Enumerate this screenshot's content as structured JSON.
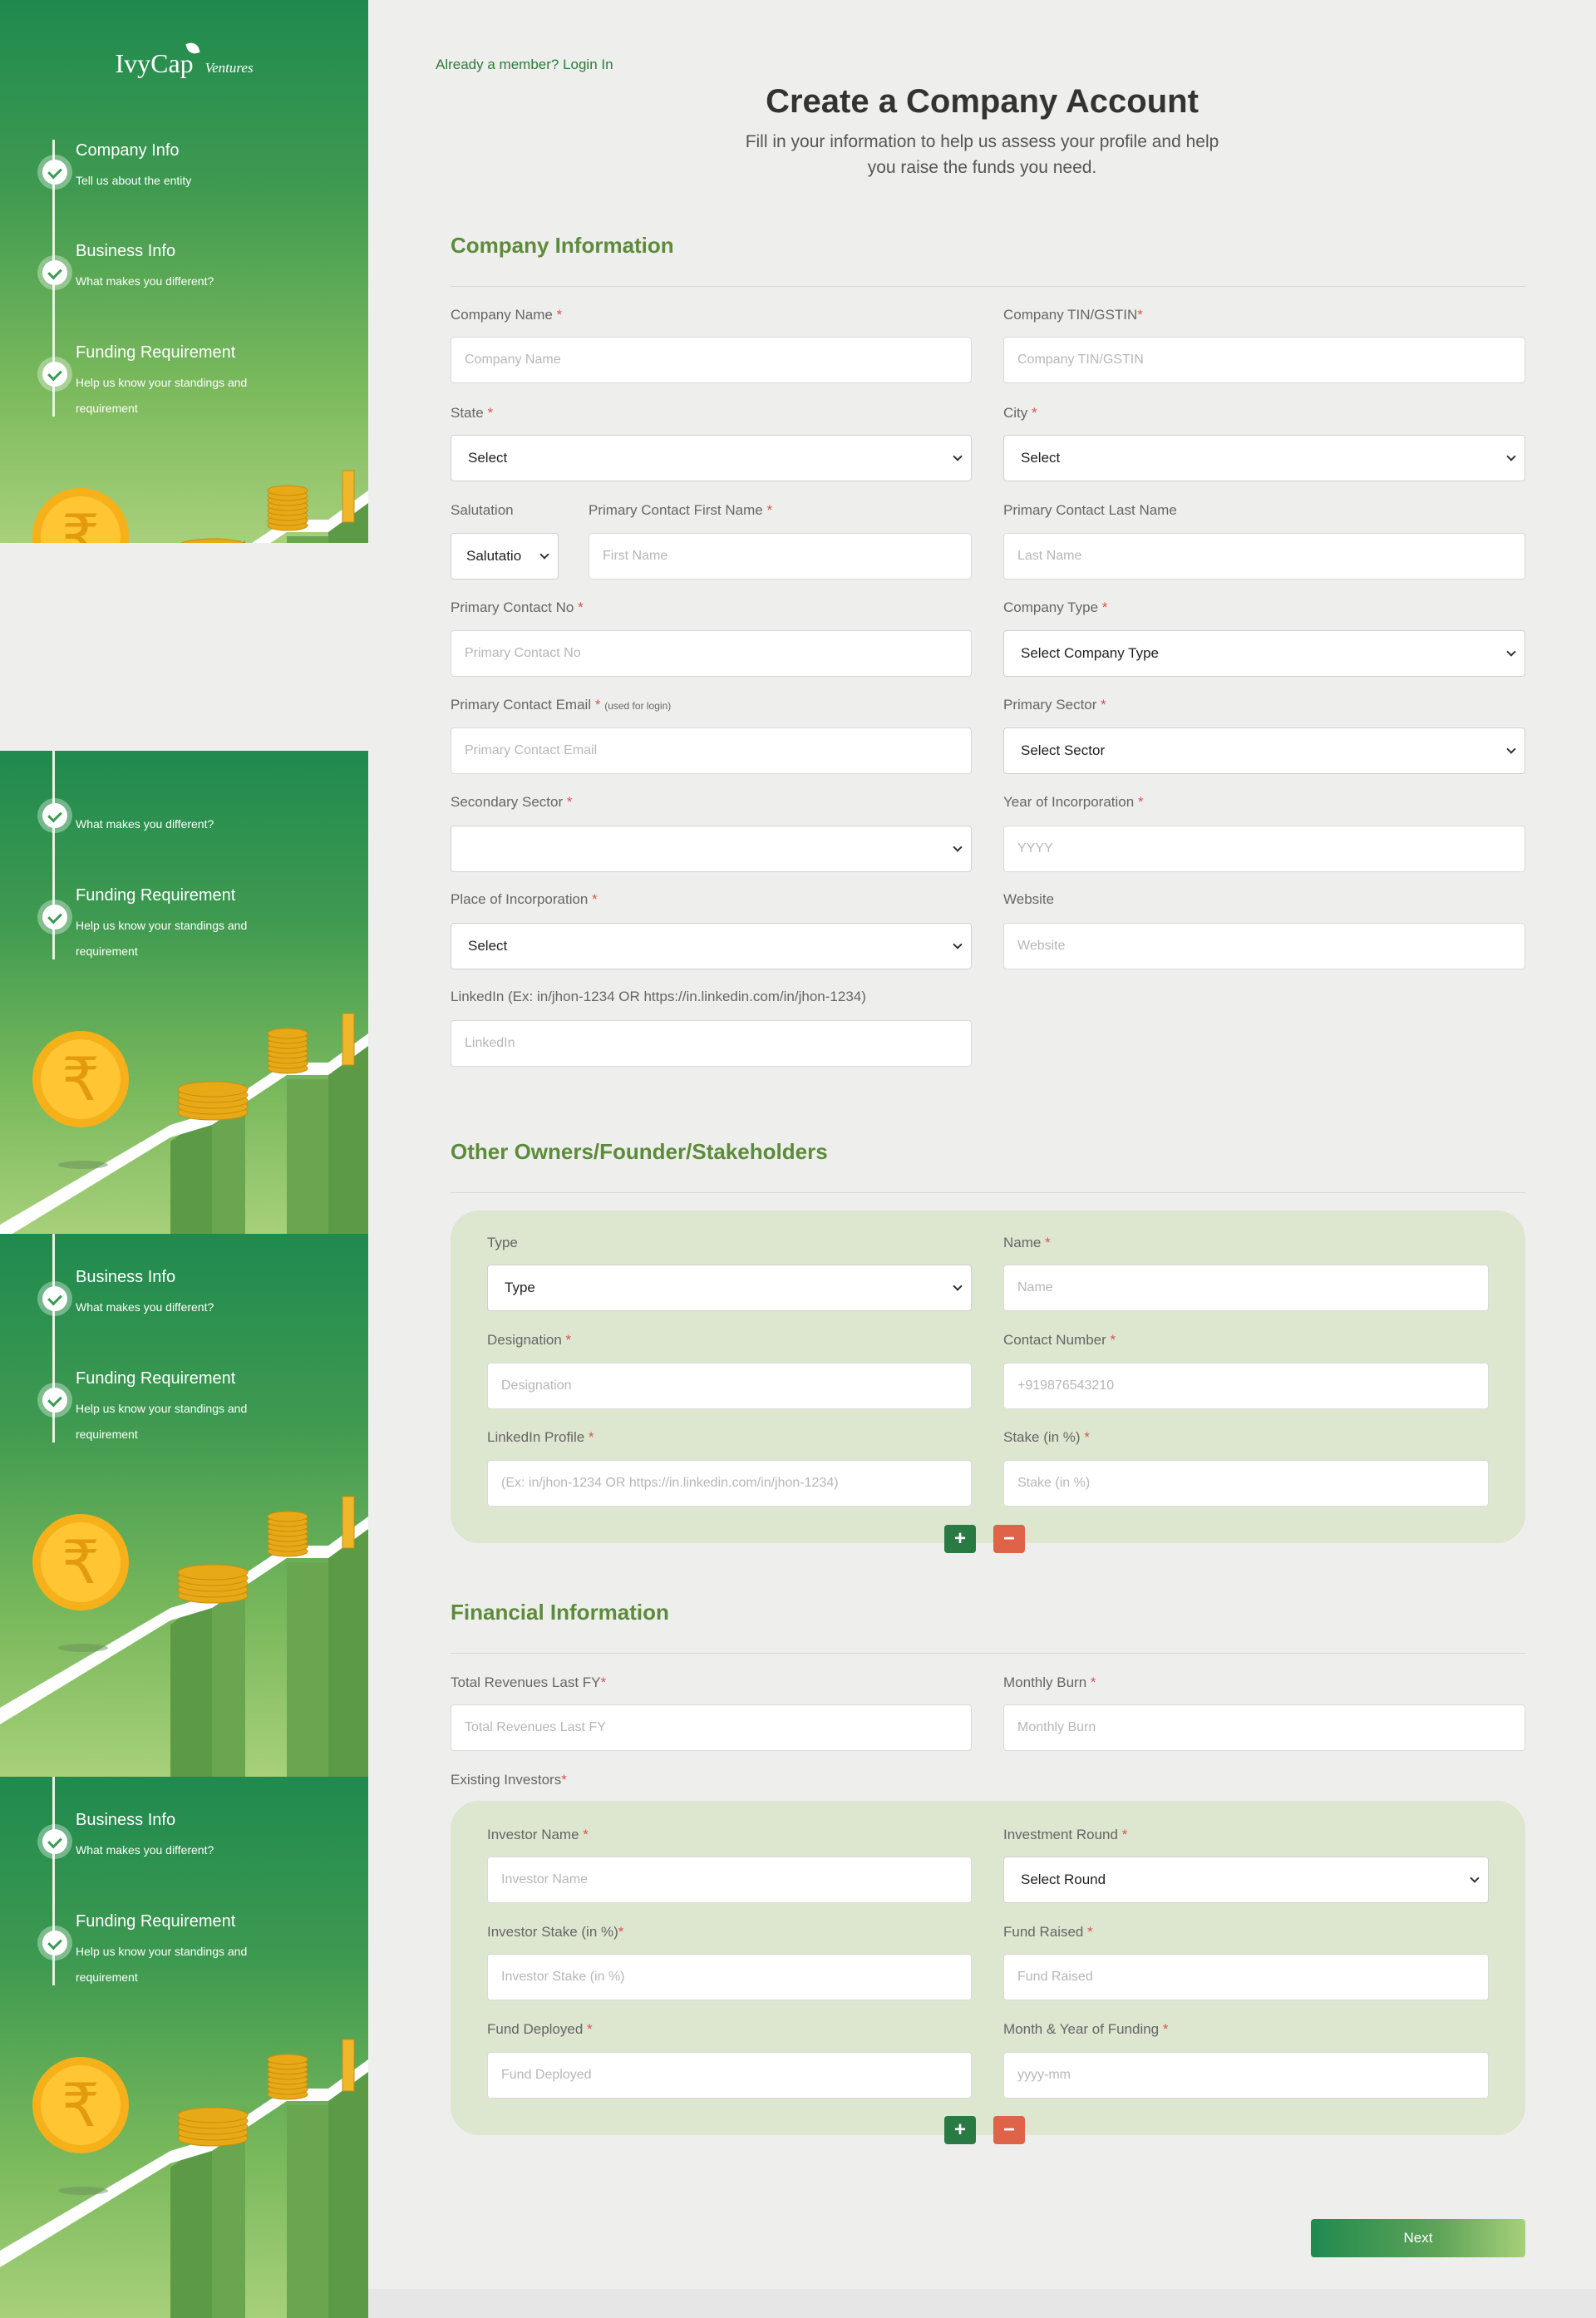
{
  "brand": {
    "name": "IvyCap",
    "suffix": "Ventures"
  },
  "sidebar": {
    "panels": [
      {
        "steps": [
          {
            "title": "Company Info",
            "desc": "Tell us about the entity"
          },
          {
            "title": "Business Info",
            "desc": "What makes you different?"
          },
          {
            "title": "Funding Requirement",
            "desc": "Help us know your standings and requirement"
          }
        ]
      },
      {
        "steps": [
          {
            "title": "",
            "desc": "What makes you different?"
          },
          {
            "title": "Funding Requirement",
            "desc": "Help us know your standings and requirement"
          }
        ]
      },
      {
        "steps": [
          {
            "title": "Business Info",
            "desc": "What makes you different?"
          },
          {
            "title": "Funding Requirement",
            "desc": "Help us know your standings and requirement"
          }
        ]
      },
      {
        "steps": [
          {
            "title": "Business Info",
            "desc": "What makes you different?"
          },
          {
            "title": "Funding Requirement",
            "desc": "Help us know your standings and requirement"
          }
        ]
      }
    ],
    "rupee_symbol": "₹"
  },
  "header": {
    "login_link": "Already a member? Login In",
    "title": "Create a Company Account",
    "subtitle_line1": "Fill in your information to help us assess your profile and help",
    "subtitle_line2": "you raise the funds you need."
  },
  "company": {
    "section_title": "Company Information",
    "company_name": {
      "label": "Company Name",
      "placeholder": "Company Name"
    },
    "tin": {
      "label": "Company TIN/GSTIN",
      "placeholder": "Company TIN/GSTIN"
    },
    "state": {
      "label": "State",
      "value": "Select"
    },
    "city": {
      "label": "City",
      "value": "Select"
    },
    "salutation": {
      "label": "Salutation",
      "value": "Salutatio"
    },
    "first_name": {
      "label": "Primary Contact First Name",
      "placeholder": "First Name"
    },
    "last_name": {
      "label": "Primary Contact Last Name",
      "placeholder": "Last Name"
    },
    "contact_no": {
      "label": "Primary Contact No",
      "placeholder": "Primary Contact No"
    },
    "company_type": {
      "label": "Company Type",
      "value": "Select Company Type"
    },
    "email": {
      "label": "Primary Contact Email",
      "note": "(used for login)",
      "placeholder": "Primary Contact Email"
    },
    "primary_sector": {
      "label": "Primary Sector",
      "value": "Select Sector"
    },
    "secondary_sector": {
      "label": "Secondary Sector",
      "value": ""
    },
    "year": {
      "label": "Year of Incorporation",
      "placeholder": "YYYY"
    },
    "place": {
      "label": "Place of Incorporation",
      "value": "Select"
    },
    "website": {
      "label": "Website",
      "placeholder": "Website"
    },
    "linkedin": {
      "label": "LinkedIn (Ex: in/jhon-1234 OR https://in.linkedin.com/in/jhon-1234)",
      "placeholder": "LinkedIn"
    }
  },
  "owners": {
    "section_title": "Other Owners/Founder/Stakeholders",
    "type": {
      "label": "Type",
      "value": "Type"
    },
    "name": {
      "label": "Name",
      "placeholder": "Name"
    },
    "designation": {
      "label": "Designation",
      "placeholder": "Designation"
    },
    "contact": {
      "label": "Contact Number",
      "placeholder": "+919876543210"
    },
    "linkedin": {
      "label": "LinkedIn Profile",
      "placeholder": "(Ex: in/jhon-1234 OR https://in.linkedin.com/in/jhon-1234)"
    },
    "stake": {
      "label": "Stake (in %)",
      "placeholder": "Stake (in %)"
    },
    "add_symbol": "+",
    "remove_symbol": "−"
  },
  "financial": {
    "section_title": "Financial Information",
    "revenues": {
      "label": "Total Revenues Last FY",
      "placeholder": "Total Revenues Last FY"
    },
    "burn": {
      "label": "Monthly Burn",
      "placeholder": "Monthly Burn"
    },
    "existing_label": "Existing Investors",
    "investor_name": {
      "label": "Investor Name",
      "placeholder": "Investor Name"
    },
    "round": {
      "label": "Investment Round",
      "value": "Select Round"
    },
    "investor_stake": {
      "label": "Investor Stake (in %)",
      "placeholder": "Investor Stake (in %)"
    },
    "fund_raised": {
      "label": "Fund Raised",
      "placeholder": "Fund Raised"
    },
    "fund_deployed": {
      "label": "Fund Deployed",
      "placeholder": "Fund Deployed"
    },
    "month_year": {
      "label": "Month & Year of Funding",
      "placeholder": "yyyy-mm"
    },
    "add_symbol": "+",
    "remove_symbol": "−"
  },
  "footer": {
    "next_label": "Next"
  },
  "colors": {
    "brand_green": "#1f8a4f",
    "section_green": "#5d8b3c",
    "required": "#d9534f",
    "remove": "#de6349"
  }
}
